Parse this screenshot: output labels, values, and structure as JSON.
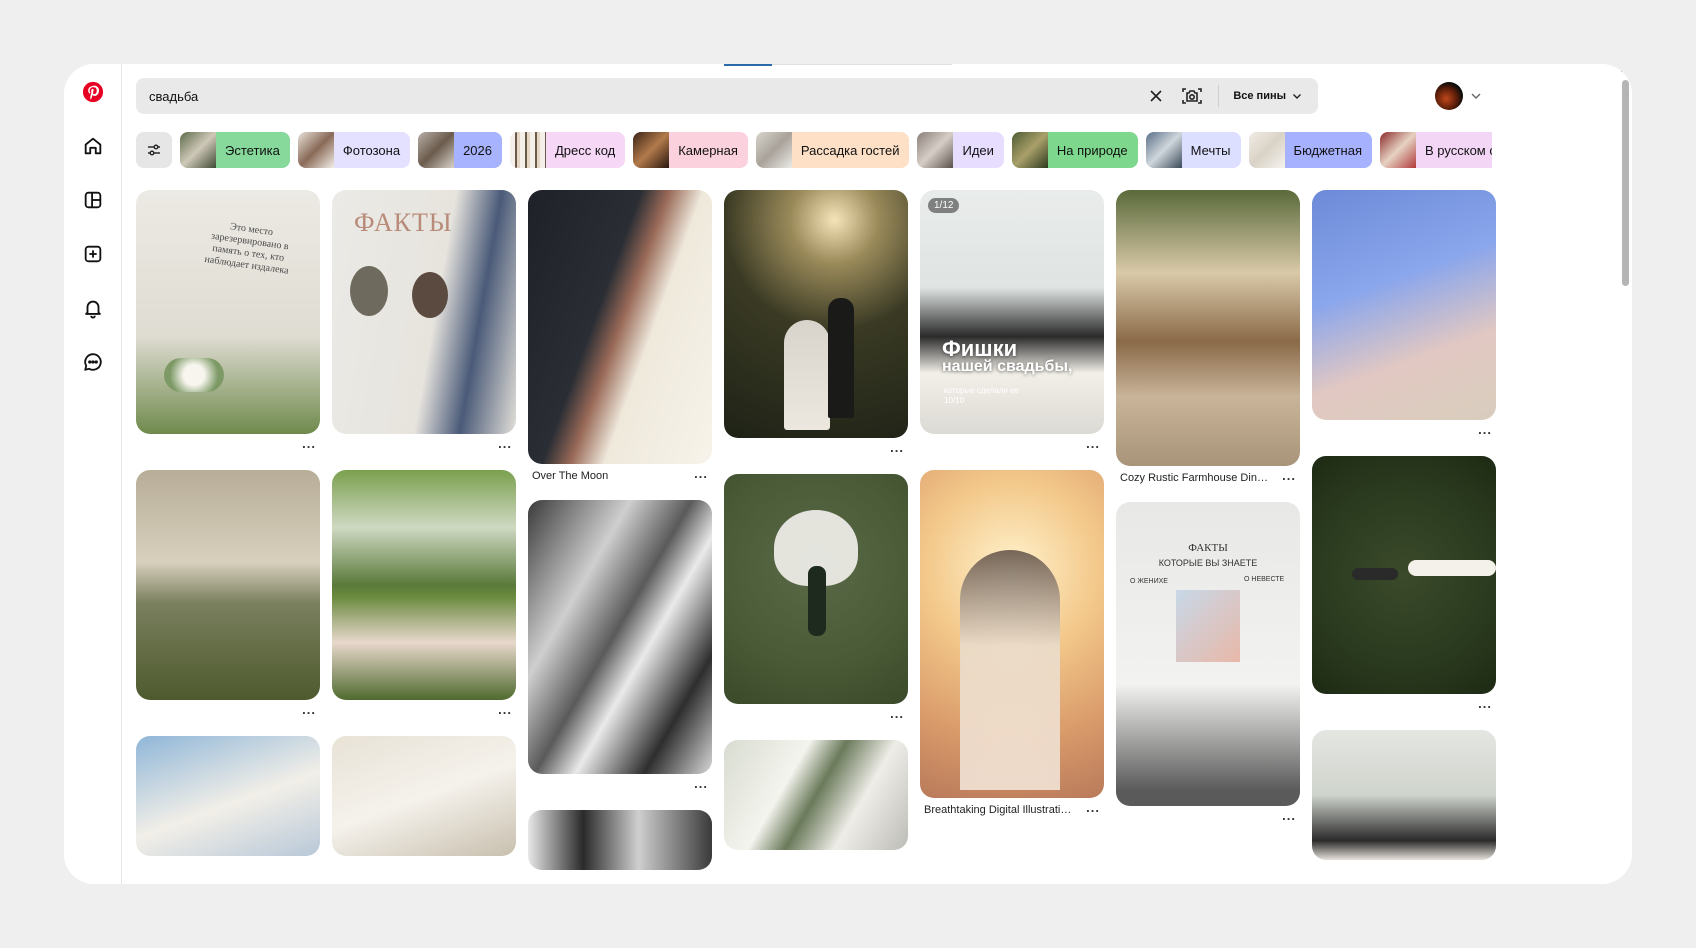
{
  "search": {
    "value": "свадьба",
    "scope_label": "Все пины"
  },
  "sidebar": {
    "items": [
      {
        "name": "pinterest-logo",
        "icon": "pinterest-logo"
      },
      {
        "name": "home",
        "icon": "home-icon"
      },
      {
        "name": "boards",
        "icon": "boards-icon"
      },
      {
        "name": "create",
        "icon": "plus-square-icon"
      },
      {
        "name": "notifications",
        "icon": "bell-icon"
      },
      {
        "name": "messages",
        "icon": "chat-icon"
      }
    ]
  },
  "chips": [
    {
      "label": "Эстетика",
      "color": "#86d99b"
    },
    {
      "label": "Фотозона",
      "color": "#e3e1ff"
    },
    {
      "label": "2026",
      "color": "#a8b3ff"
    },
    {
      "label": "Дресс код",
      "color": "#f6d7f5"
    },
    {
      "label": "Камерная",
      "color": "#fbd1de"
    },
    {
      "label": "Рассадка гостей",
      "color": "#fde0c6"
    },
    {
      "label": "Идеи",
      "color": "#e6ddff"
    },
    {
      "label": "На природе",
      "color": "#7dd88d"
    },
    {
      "label": "Мечты",
      "color": "#dcdfff"
    },
    {
      "label": "Бюджетная",
      "color": "#a6b1ff"
    },
    {
      "label": "В русском стиле",
      "color": "#f3d6f5"
    }
  ],
  "pins": {
    "c1_p1": {
      "title": "",
      "img_text": "Это место зарезервировано в память о тех, кто наблюдает издалека"
    },
    "c2_p1": {
      "title": "",
      "img_text": "ФАКТЫ"
    },
    "c3_p1": {
      "title": "Over The Moon"
    },
    "c4_p1": {
      "title": ""
    },
    "c5_p1": {
      "title": "",
      "badge": "1/12",
      "overlay_title_1": "Фишки",
      "overlay_title_2": "нашей свадьбы,",
      "overlay_sub": "которые сделали ее 10/10"
    },
    "c6_p1": {
      "title": "Cozy Rustic Farmhouse Dining..."
    },
    "c7_p1": {
      "title": ""
    },
    "c1_p2": {
      "title": ""
    },
    "c2_p2": {
      "title": ""
    },
    "c3_p2": {
      "title": ""
    },
    "c4_p2": {
      "title": ""
    },
    "c5_p2": {
      "title": "Breathtaking Digital Illustratio..."
    },
    "c6_p2": {
      "title": "",
      "img_text_1": "ФАКТЫ",
      "img_text_2": "КОТОРЫЕ ВЫ ЗНАЕТЕ",
      "img_text_3": "О ЖЕНИХЕ",
      "img_text_4": "О НЕВЕСТЕ"
    },
    "c7_p2": {
      "title": ""
    }
  },
  "more_label": "..."
}
